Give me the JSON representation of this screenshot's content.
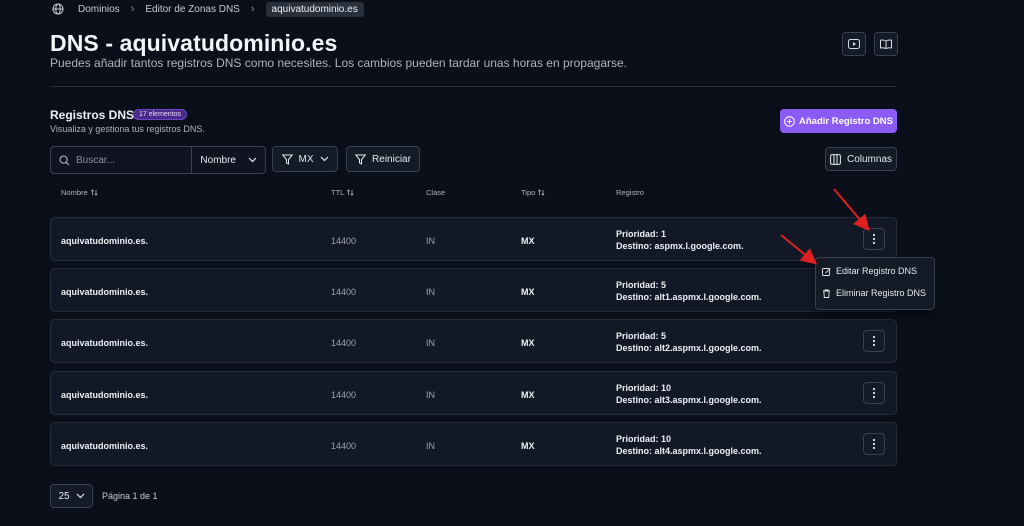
{
  "breadcrumb": {
    "icon": "globe-icon",
    "items": [
      "Dominios",
      "Editor de Zonas DNS",
      "aquivatudominio.es"
    ]
  },
  "header": {
    "title": "DNS - aquivatudominio.es",
    "subtitle": "Puedes añadir tantos registros DNS como necesites. Los cambios pueden tardar unas horas en propagarse.",
    "icons": [
      "video-icon",
      "book-icon"
    ]
  },
  "section": {
    "title": "Registros DNS",
    "badge": "17 elementos",
    "subtitle": "Visualiza y gestiona tus registros DNS.",
    "add_button": "Añadir Registro DNS"
  },
  "toolbar": {
    "search_placeholder": "Buscar...",
    "search_field": "Nombre",
    "filter_value": "MX",
    "reset_label": "Reiniciar",
    "columns_label": "Columnas"
  },
  "table": {
    "headers": [
      "Nombre",
      "TTL",
      "Clase",
      "Tipo",
      "Registro"
    ],
    "rows": [
      {
        "name": "aquivatudominio.es.",
        "ttl": "14400",
        "class": "IN",
        "type": "MX",
        "priority": "Prioridad: 1",
        "target": "Destino: aspmx.l.google.com."
      },
      {
        "name": "aquivatudominio.es.",
        "ttl": "14400",
        "class": "IN",
        "type": "MX",
        "priority": "Prioridad: 5",
        "target": "Destino: alt1.aspmx.l.google.com."
      },
      {
        "name": "aquivatudominio.es.",
        "ttl": "14400",
        "class": "IN",
        "type": "MX",
        "priority": "Prioridad: 5",
        "target": "Destino: alt2.aspmx.l.google.com."
      },
      {
        "name": "aquivatudominio.es.",
        "ttl": "14400",
        "class": "IN",
        "type": "MX",
        "priority": "Prioridad: 10",
        "target": "Destino: alt3.aspmx.l.google.com."
      },
      {
        "name": "aquivatudominio.es.",
        "ttl": "14400",
        "class": "IN",
        "type": "MX",
        "priority": "Prioridad: 10",
        "target": "Destino: alt4.aspmx.l.google.com."
      }
    ]
  },
  "row_menu": {
    "edit": "Editar Registro DNS",
    "delete": "Eliminar Registro DNS"
  },
  "pagination": {
    "per_page": "25",
    "info": "Página 1 de 1"
  },
  "colors": {
    "background": "#0b0f1a",
    "accent": "#8a5cf5",
    "annotation_arrow": "#e02020"
  }
}
